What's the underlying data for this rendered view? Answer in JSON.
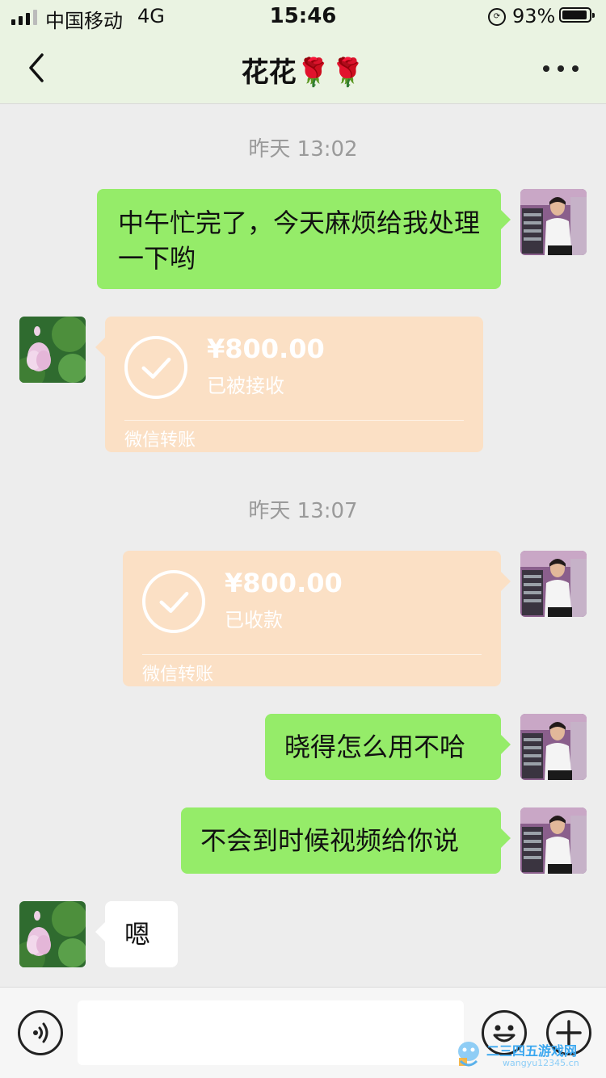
{
  "status_bar": {
    "carrier": "中国移动",
    "network": "4G",
    "time": "15:46",
    "battery_percent": "93%",
    "battery_level": 0.93
  },
  "header": {
    "title": "花花🌹🌹",
    "back_icon": "chevron-left-icon",
    "more_icon": "more-horizontal-icon"
  },
  "messages": [
    {
      "type": "timestamp",
      "text": "昨天 13:02"
    },
    {
      "type": "text",
      "side": "right",
      "text": "中午忙完了，今天麻烦给我处理一下哟"
    },
    {
      "type": "transfer",
      "side": "left",
      "amount": "¥800.00",
      "status": "已被接收",
      "label": "微信转账"
    },
    {
      "type": "timestamp",
      "text": "昨天 13:07"
    },
    {
      "type": "transfer",
      "side": "right",
      "amount": "¥800.00",
      "status": "已收款",
      "label": "微信转账"
    },
    {
      "type": "text",
      "side": "right",
      "text": "晓得怎么用不哈"
    },
    {
      "type": "text",
      "side": "right",
      "text": "不会到时候视频给你说"
    },
    {
      "type": "text",
      "side": "left",
      "text": "嗯"
    }
  ],
  "toolbar": {
    "voice_icon": "voice-icon",
    "emoji_icon": "emoji-icon",
    "plus_icon": "plus-icon"
  },
  "watermark": {
    "text": "二三四五游戏网",
    "sub": "wangyu12345.cn"
  },
  "colors": {
    "header_bg": "#eaf3e2",
    "chat_bg": "#ededed",
    "bubble_green": "#95ec69",
    "transfer_orange": "#fbe0c5"
  }
}
